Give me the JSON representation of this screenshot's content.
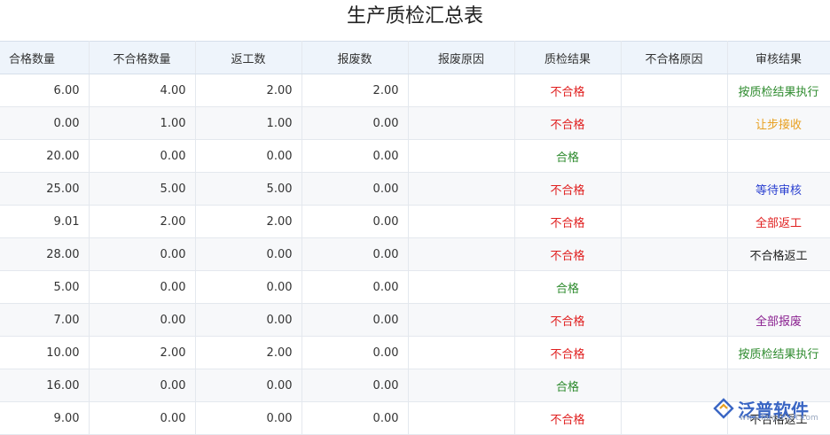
{
  "page": {
    "title": "生产质检汇总表"
  },
  "table": {
    "headers": [
      "合格数量",
      "不合格数量",
      "返工数",
      "报废数",
      "报废原因",
      "质检结果",
      "不合格原因",
      "审核结果"
    ],
    "rows": [
      {
        "qualified": "6.00",
        "unqualified": "4.00",
        "rework": "2.00",
        "scrap": "2.00",
        "scrap_reason": "",
        "qc_result": "不合格",
        "qc_color": "#e02020",
        "unqualified_reason": "",
        "review": "按质检结果执行",
        "review_color": "#2e8b2e"
      },
      {
        "qualified": "0.00",
        "unqualified": "1.00",
        "rework": "1.00",
        "scrap": "0.00",
        "scrap_reason": "",
        "qc_result": "不合格",
        "qc_color": "#e02020",
        "unqualified_reason": "",
        "review": "让步接收",
        "review_color": "#e8a020"
      },
      {
        "qualified": "20.00",
        "unqualified": "0.00",
        "rework": "0.00",
        "scrap": "0.00",
        "scrap_reason": "",
        "qc_result": "合格",
        "qc_color": "#2e8b2e",
        "unqualified_reason": "",
        "review": "",
        "review_color": "#222222"
      },
      {
        "qualified": "25.00",
        "unqualified": "5.00",
        "rework": "5.00",
        "scrap": "0.00",
        "scrap_reason": "",
        "qc_result": "不合格",
        "qc_color": "#e02020",
        "unqualified_reason": "",
        "review": "等待审核",
        "review_color": "#2a3fd0"
      },
      {
        "qualified": "9.01",
        "unqualified": "2.00",
        "rework": "2.00",
        "scrap": "0.00",
        "scrap_reason": "",
        "qc_result": "不合格",
        "qc_color": "#e02020",
        "unqualified_reason": "",
        "review": "全部返工",
        "review_color": "#e02020"
      },
      {
        "qualified": "28.00",
        "unqualified": "0.00",
        "rework": "0.00",
        "scrap": "0.00",
        "scrap_reason": "",
        "qc_result": "不合格",
        "qc_color": "#e02020",
        "unqualified_reason": "",
        "review": "不合格返工",
        "review_color": "#222222"
      },
      {
        "qualified": "5.00",
        "unqualified": "0.00",
        "rework": "0.00",
        "scrap": "0.00",
        "scrap_reason": "",
        "qc_result": "合格",
        "qc_color": "#2e8b2e",
        "unqualified_reason": "",
        "review": "",
        "review_color": "#222222"
      },
      {
        "qualified": "7.00",
        "unqualified": "0.00",
        "rework": "0.00",
        "scrap": "0.00",
        "scrap_reason": "",
        "qc_result": "不合格",
        "qc_color": "#e02020",
        "unqualified_reason": "",
        "review": "全部报废",
        "review_color": "#8a2090"
      },
      {
        "qualified": "10.00",
        "unqualified": "2.00",
        "rework": "2.00",
        "scrap": "0.00",
        "scrap_reason": "",
        "qc_result": "不合格",
        "qc_color": "#e02020",
        "unqualified_reason": "",
        "review": "按质检结果执行",
        "review_color": "#2e8b2e"
      },
      {
        "qualified": "16.00",
        "unqualified": "0.00",
        "rework": "0.00",
        "scrap": "0.00",
        "scrap_reason": "",
        "qc_result": "合格",
        "qc_color": "#2e8b2e",
        "unqualified_reason": "",
        "review": "",
        "review_color": "#222222"
      },
      {
        "qualified": "9.00",
        "unqualified": "0.00",
        "rework": "0.00",
        "scrap": "0.00",
        "scrap_reason": "",
        "qc_result": "不合格",
        "qc_color": "#e02020",
        "unqualified_reason": "",
        "review": "不合格返工",
        "review_color": "#222222"
      }
    ]
  },
  "watermark": {
    "text": "泛普软件",
    "sub": "www.fanpusoft.com",
    "icon": "fanpu-logo-icon"
  }
}
